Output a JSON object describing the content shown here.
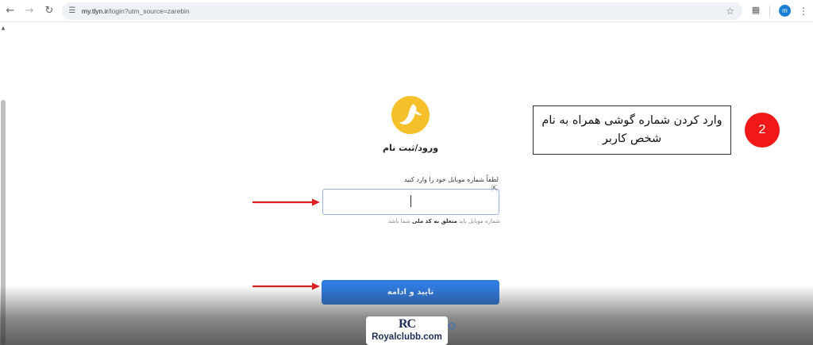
{
  "browser": {
    "url_host": "my.tlyn.ir",
    "url_path": "/login?utm_source=zarebin",
    "profile_initial": "m"
  },
  "page": {
    "title": "ورود/ثبت نام",
    "input_label": "لطفاً شماره موبایل خود را وارد کنید",
    "phone_value": "",
    "helper_prefix": "شماره موبایل باید ",
    "helper_strong": "متعلق به کد ملی",
    "helper_suffix": " شما باشد",
    "submit_label": "تایید و ادامه"
  },
  "annotation": {
    "callout": "وارد کردن شماره گوشی همراه به نام شخص کاربر",
    "step_number": "2",
    "arrow_color": "#e02020",
    "badge_color": "#f01818"
  },
  "watermark": {
    "mark": "RC",
    "text": "Royalclubb.com"
  },
  "colors": {
    "primary": "#2f7be0",
    "logo": "#f5c02a"
  },
  "icons": {
    "back": "arrow-left-icon",
    "forward": "arrow-right-icon",
    "reload": "reload-icon",
    "site_info": "tune-icon",
    "bookmark": "star-icon",
    "extensions": "puzzle-icon",
    "menu": "more-vert-icon"
  }
}
